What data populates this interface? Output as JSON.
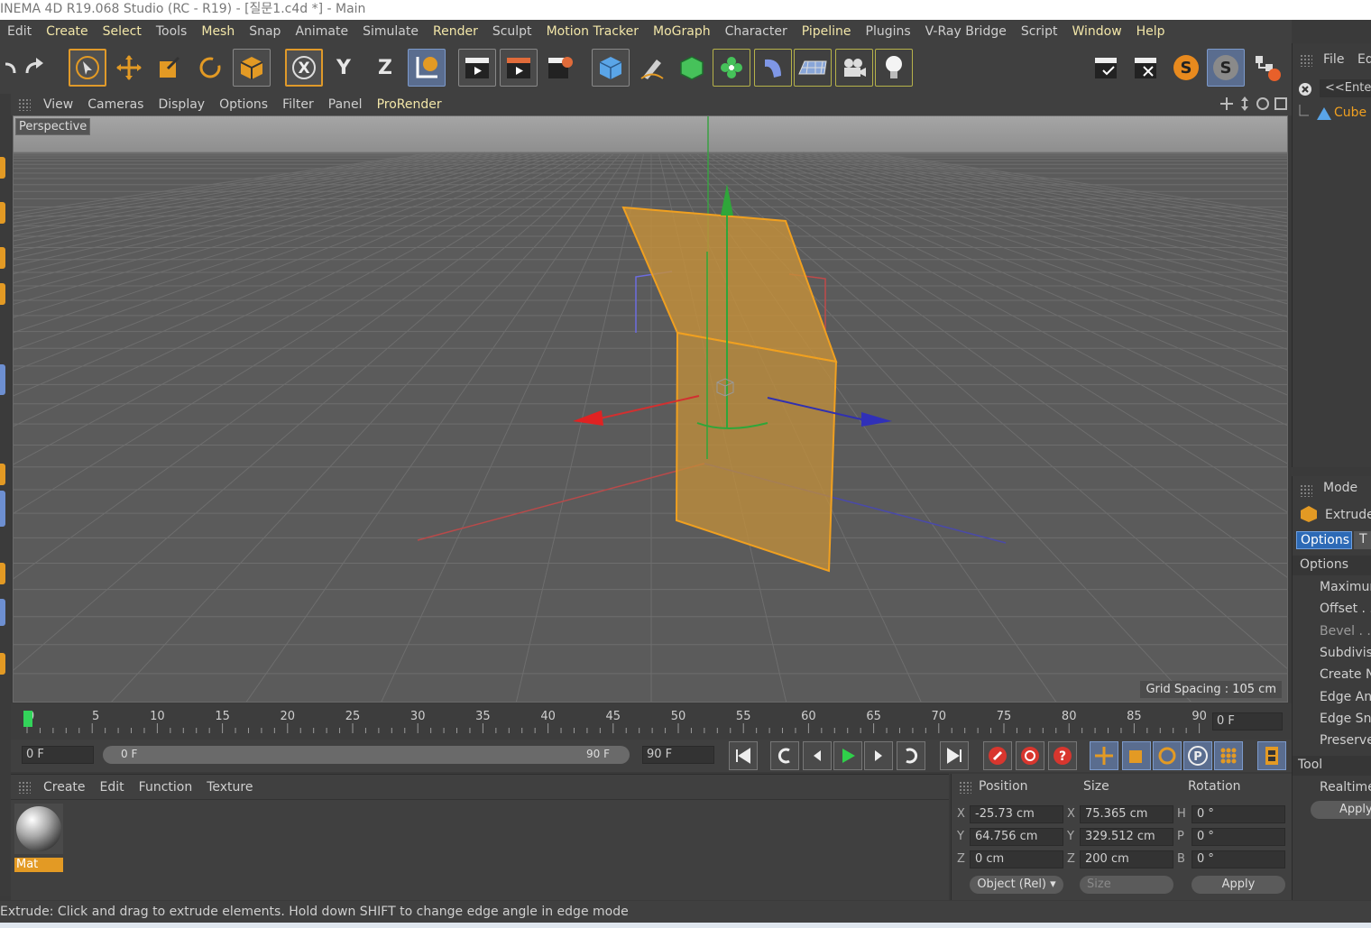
{
  "title": "INEMA 4D R19.068 Studio (RC - R19) - [질문1.c4d *] - Main",
  "menu": [
    {
      "label": "Edit",
      "hl": false
    },
    {
      "label": "Create",
      "hl": true
    },
    {
      "label": "Select",
      "hl": true
    },
    {
      "label": "Tools",
      "hl": false
    },
    {
      "label": "Mesh",
      "hl": true
    },
    {
      "label": "Snap",
      "hl": false
    },
    {
      "label": "Animate",
      "hl": false
    },
    {
      "label": "Simulate",
      "hl": false
    },
    {
      "label": "Render",
      "hl": true
    },
    {
      "label": "Sculpt",
      "hl": false
    },
    {
      "label": "Motion Tracker",
      "hl": true
    },
    {
      "label": "MoGraph",
      "hl": true
    },
    {
      "label": "Character",
      "hl": false
    },
    {
      "label": "Pipeline",
      "hl": true
    },
    {
      "label": "Plugins",
      "hl": false
    },
    {
      "label": "V-Ray Bridge",
      "hl": false
    },
    {
      "label": "Script",
      "hl": false
    },
    {
      "label": "Window",
      "hl": true
    },
    {
      "label": "Help",
      "hl": true
    }
  ],
  "toolbar": {
    "x_label": "X",
    "y_label": "Y",
    "z_label": "Z"
  },
  "viewport": {
    "menu": [
      "View",
      "Cameras",
      "Display",
      "Options",
      "Filter",
      "Panel",
      "ProRender"
    ],
    "label": "Perspective",
    "grid_spacing": "Grid Spacing : 105 cm"
  },
  "timeline": {
    "ticks": [
      "0",
      "5",
      "10",
      "15",
      "20",
      "25",
      "30",
      "35",
      "40",
      "45",
      "50",
      "55",
      "60",
      "65",
      "70",
      "75",
      "80",
      "85",
      "90"
    ],
    "frame_right": "0 F",
    "start_field": "0 F",
    "range_start": "0 F",
    "range_end": "90 F",
    "end_field": "90 F"
  },
  "materials": {
    "menu": [
      "Create",
      "Edit",
      "Function",
      "Texture"
    ],
    "items": [
      {
        "name": "Mat"
      }
    ]
  },
  "coords": {
    "headers": {
      "position": "Position",
      "size": "Size",
      "rotation": "Rotation"
    },
    "pos": {
      "x": "-25.73 cm",
      "y": "64.756 cm",
      "z": "0 cm"
    },
    "size": {
      "x": "75.365 cm",
      "y": "329.512 cm",
      "z": "200 cm"
    },
    "rot": {
      "h": "0 °",
      "p": "0 °",
      "b": "0 °"
    },
    "axis_labels": {
      "x": "X",
      "y": "Y",
      "z": "Z",
      "h": "H",
      "p": "P",
      "b": "B"
    },
    "mode": "Object (Rel) ▾",
    "size_mode": "Size",
    "apply": "Apply"
  },
  "object_manager": {
    "menu": [
      "File",
      "Ed"
    ],
    "search": "<<Ente",
    "objects": [
      "Cube"
    ]
  },
  "attributes": {
    "mode": "Mode",
    "tool_name": "Extrude",
    "tabs": [
      "Options",
      "T"
    ],
    "section": "Options",
    "options": [
      "Maximum",
      "Offset . .",
      "Bevel . . .",
      "Subdivisi",
      "Create N",
      "Edge Ang",
      "Edge Sna",
      "Preserve"
    ],
    "tool_section": "Tool",
    "realtime": "Realtime",
    "apply": "Apply"
  },
  "status": "Extrude: Click and drag to extrude elements. Hold down SHIFT to change edge angle in edge mode",
  "colors": {
    "accent": "#e39a24",
    "highlight_text": "#f2e6a8",
    "selection_blue": "#5a6d8f"
  }
}
